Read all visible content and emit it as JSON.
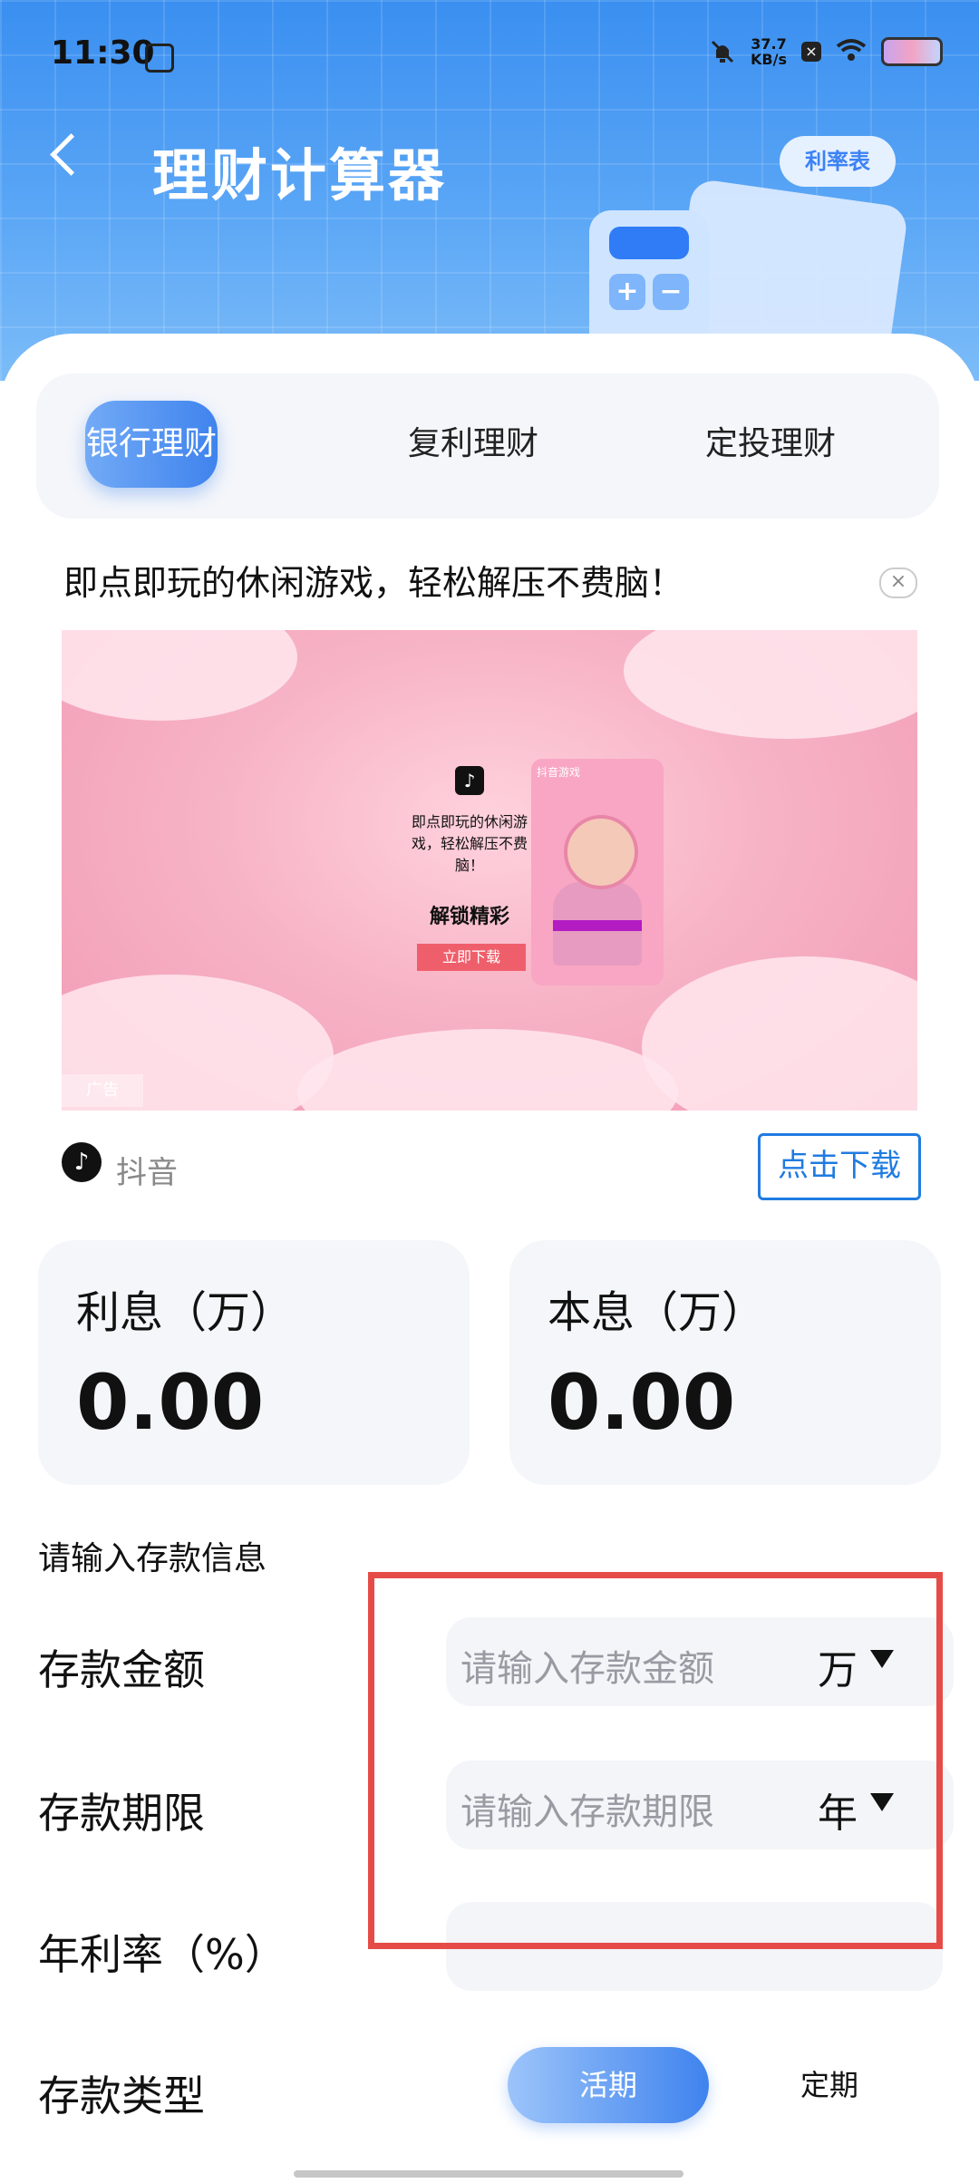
{
  "status_bar": {
    "time": "11:30",
    "speed": "37.7",
    "speed_unit": "KB/s"
  },
  "header": {
    "title": "理财计算器",
    "rate_table_label": "利率表"
  },
  "tabs": [
    {
      "label": "银行理财",
      "active": true
    },
    {
      "label": "复利理财",
      "active": false
    },
    {
      "label": "定投理财",
      "active": false
    }
  ],
  "ad": {
    "headline": "即点即玩的休闲游戏，轻松解压不费脑！",
    "image_text": "即点即玩的休闲游戏，轻松解压不费脑！",
    "unlock_text": "解锁精彩",
    "download_small": "立即下载",
    "phone_label": "抖音游戏",
    "tag": "广告",
    "advertiser": "抖音",
    "download_button": "点击下载"
  },
  "results": {
    "interest_label": "利息（万）",
    "interest_value": "0.00",
    "total_label": "本息（万）",
    "total_value": "0.00"
  },
  "form": {
    "section_title": "请输入存款信息",
    "amount": {
      "label": "存款金额",
      "placeholder": "请输入存款金额",
      "unit": "万"
    },
    "term": {
      "label": "存款期限",
      "placeholder": "请输入存款期限",
      "unit": "年"
    },
    "rate": {
      "label": "年利率（%）",
      "value": ""
    },
    "type": {
      "label": "存款类型",
      "options": [
        "活期",
        "定期"
      ],
      "selected": "活期"
    }
  },
  "colors": {
    "accent": "#3f83ee",
    "highlight": "#e64c47",
    "header_top": "#3a8ff0"
  }
}
